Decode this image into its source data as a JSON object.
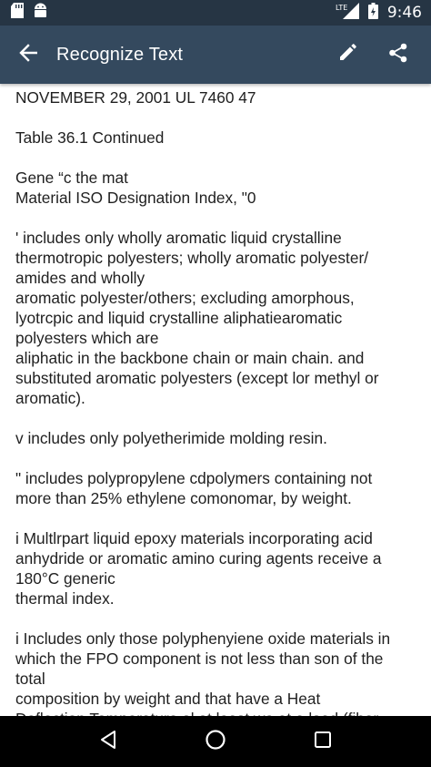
{
  "status_bar": {
    "time": "9:46",
    "network": "LTE",
    "icons": [
      "sd-card-icon",
      "android-icon",
      "signal-icon",
      "battery-icon"
    ]
  },
  "app_bar": {
    "title": "Recognize Text",
    "icons": [
      "back-arrow-icon",
      "pencil-icon",
      "share-icon"
    ]
  },
  "content": {
    "paragraphs": [
      "NOVEMBER 29, 2001 UL 7460 47",
      "Table 36.1 Continued",
      "Gene “c the mat\nMaterial ISO Designation Index, \"0",
      "' includes only wholly aromatic liquid crystalline\nthermotropic polyesters; wholly aromatic polyester/\namides and wholly\naromatic polyester/others; excluding amorphous,\nlyotrcpic and liquid crystalline aliphatiearomatic\npolyesters which are\naliphatic in the backbone chain or main chain. and\nsubstituted aromatic polyesters (except lor methyl or\naromatic).",
      "v includes only polyetherimide molding resin.",
      "\" includes polypropylene cdpolymers containing not\nmore than 25% ethylene comonomar, by weight.",
      "i Multlrpart liquid epoxy materials incorporating acid\nanhydride or aromatic amino curing agents receive a\n180°C generic\nthermal index.",
      "i Includes only those polyphenyiene oxide materials in\nwhich the FPO component is not less than son of the\ntotal\ncomposition by weight and that have a Heat\nDeflection Temperature ol at least we at a load (fiber"
    ]
  },
  "nav_bar": {
    "icons": [
      "back-triangle-icon",
      "home-circle-icon",
      "recents-square-icon"
    ]
  },
  "colors": {
    "status_bar": "#263544",
    "app_bar": "#34495e",
    "text": "#1f1f1f"
  }
}
